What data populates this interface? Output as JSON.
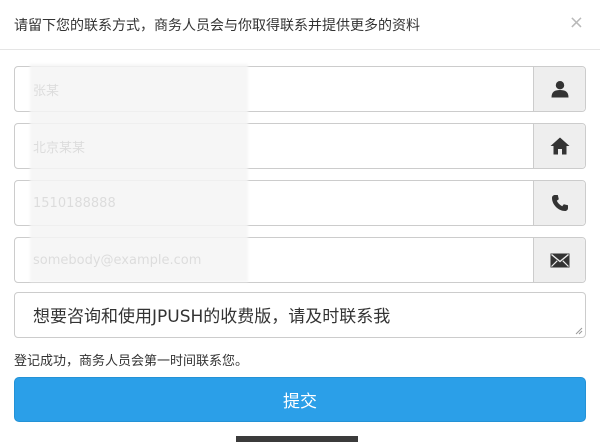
{
  "header": {
    "title": "请留下您的联系方式，商务人员会与你取得联系并提供更多的资料",
    "close_label": "×"
  },
  "form": {
    "fields": [
      {
        "name": "name",
        "value": "张某",
        "icon": "user-icon"
      },
      {
        "name": "company",
        "value": "北京某某",
        "icon": "home-icon"
      },
      {
        "name": "phone",
        "value": "1510188888",
        "icon": "phone-icon"
      },
      {
        "name": "email",
        "value": "somebody@example.com",
        "icon": "envelope-icon"
      }
    ],
    "message": "想要咨询和使用JPUSH的收费版，请及时联系我",
    "status": "登记成功，商务人员会第一时间联系您。",
    "submit_label": "提交"
  },
  "colors": {
    "accent": "#2b9fe8",
    "border": "#cccccc",
    "addon_bg": "#eeeeee",
    "icon": "#333333"
  }
}
